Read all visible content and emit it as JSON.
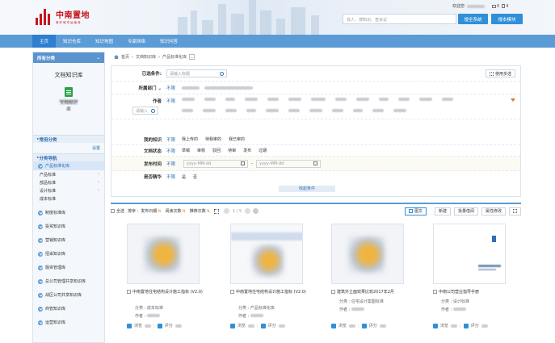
{
  "brand": {
    "name_cn": "中南置地",
    "slogan": "美好城市运营商"
  },
  "header": {
    "welcome": "欢迎您",
    "msg_count": "0",
    "notice_count": "4",
    "search_placeholder": "找人、搜知识、查会议",
    "search_btn": "搜全系统",
    "module_btn": "搜本模块"
  },
  "nav": [
    "主页",
    "知识仓库",
    "知识地图",
    "专家网络",
    "知识问答"
  ],
  "sidebar": {
    "header": "所有分类",
    "title": "文档知识库",
    "doc_caption": "文档知识库",
    "common_cat": "常用分类",
    "setting": "设置",
    "nav_title": "分类导航",
    "selected": "产品标准化库",
    "subs": [
      "产品标准",
      "部品标准",
      "设计标准",
      "成本标准"
    ],
    "items": [
      "制度标准库",
      "投资知识库",
      "营销知识库",
      "招采知识库",
      "融资管理库",
      "总公司管理共享知识库",
      "战区公司共享知识库",
      "商管知识库",
      "运营知识库"
    ]
  },
  "breadcrumb": [
    "首页",
    "文档知识库",
    "产品标准化库"
  ],
  "filter": {
    "selected_label": "已选条件:",
    "selected_placeholder": "请输入标题",
    "multi_btn": "使用多选",
    "dept_label": "所属部门",
    "author_label": "作者",
    "author_input": "请输入",
    "my_label": "我的知识",
    "my_opts": [
      "我上传的",
      "待我审的",
      "我已审的"
    ],
    "status_label": "文档状态",
    "status_opts": [
      "草稿",
      "审核",
      "驳回",
      "待审",
      "发布",
      "过期"
    ],
    "time_label": "发布时间",
    "date_placeholder": "yyyy-MM-dd",
    "date_sep": "-",
    "excellent_label": "是否精华",
    "excellent_opts": [
      "是",
      "否"
    ],
    "all": "不限",
    "collapse": "收起条件"
  },
  "toolbar": {
    "select_all": "全选",
    "sort_label": "排序 :",
    "sorts": [
      "发布日期",
      "阅读次数",
      "推荐次数"
    ],
    "page": "1 / 5",
    "view_btn": "图文",
    "new_btn": "新建",
    "batch_btn": "批量借阅",
    "attr_btn": "属性修改"
  },
  "cards": [
    {
      "title": "中南置地住宅结构设计施工指标 (V2.0)",
      "category": "成本标准"
    },
    {
      "title": "中南置地住宅结构设计施工指标 (V2.0)",
      "category": "产品标准化库"
    },
    {
      "title": "建筑外立面效果比较2017年2月",
      "category": "住宅设计案图标准"
    },
    {
      "title": "中南公司营业指导手册",
      "category": "设计标准"
    }
  ],
  "card_labels": {
    "category": "分类 :",
    "author": "作者 :",
    "read": "浏览",
    "score": "评分"
  }
}
